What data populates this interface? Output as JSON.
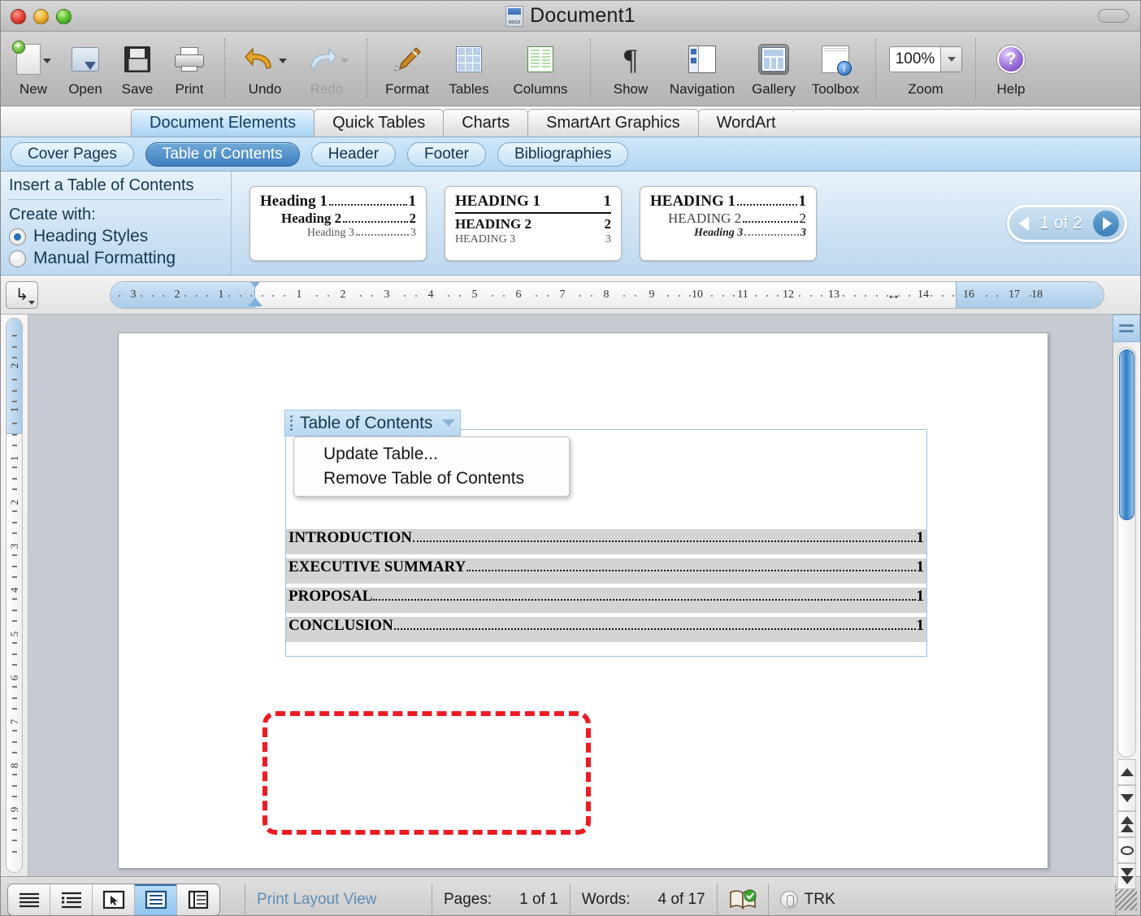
{
  "window": {
    "title": "Document1",
    "doc_icon": "docx-file-icon",
    "traffic_lights": [
      "close",
      "minimize",
      "zoom"
    ]
  },
  "toolbar": {
    "items": [
      {
        "label": "New",
        "icon": "new-document-icon",
        "has_menu": true,
        "disabled": false
      },
      {
        "label": "Open",
        "icon": "open-folder-icon",
        "has_menu": false,
        "disabled": false
      },
      {
        "label": "Save",
        "icon": "floppy-disk-icon",
        "has_menu": false,
        "disabled": false
      },
      {
        "label": "Print",
        "icon": "printer-icon",
        "has_menu": false,
        "disabled": false
      },
      {
        "label": "Undo",
        "icon": "undo-arrow-icon",
        "has_menu": true,
        "disabled": false
      },
      {
        "label": "Redo",
        "icon": "redo-arrow-icon",
        "has_menu": true,
        "disabled": true
      },
      {
        "label": "Format",
        "icon": "paintbrush-icon",
        "has_menu": false,
        "disabled": false
      },
      {
        "label": "Tables",
        "icon": "table-grid-icon",
        "has_menu": false,
        "disabled": false
      },
      {
        "label": "Columns",
        "icon": "columns-icon",
        "has_menu": false,
        "disabled": false
      },
      {
        "label": "Show",
        "icon": "pilcrow-icon",
        "has_menu": false,
        "disabled": false
      },
      {
        "label": "Navigation",
        "icon": "navigation-pane-icon",
        "has_menu": false,
        "disabled": false
      },
      {
        "label": "Gallery",
        "icon": "gallery-icon",
        "has_menu": false,
        "disabled": false
      },
      {
        "label": "Toolbox",
        "icon": "toolbox-info-icon",
        "has_menu": false,
        "disabled": false
      },
      {
        "label": "Zoom",
        "icon": "zoom-combo-icon",
        "has_menu": true,
        "disabled": false
      },
      {
        "label": "Help",
        "icon": "help-question-icon",
        "has_menu": false,
        "disabled": false
      }
    ],
    "zoom_value": "100%"
  },
  "ribbon": {
    "tabs": [
      {
        "label": "Document Elements",
        "active": true
      },
      {
        "label": "Quick Tables",
        "active": false
      },
      {
        "label": "Charts",
        "active": false
      },
      {
        "label": "SmartArt Graphics",
        "active": false
      },
      {
        "label": "WordArt",
        "active": false
      }
    ],
    "subtabs": [
      {
        "label": "Cover Pages",
        "active": false
      },
      {
        "label": "Table of Contents",
        "active": true
      },
      {
        "label": "Header",
        "active": false
      },
      {
        "label": "Footer",
        "active": false
      },
      {
        "label": "Bibliographies",
        "active": false
      }
    ]
  },
  "gallery": {
    "insert_title": "Insert a Table of Contents",
    "create_with_label": "Create with:",
    "options": [
      {
        "label": "Heading Styles",
        "selected": true
      },
      {
        "label": "Manual Formatting",
        "selected": false
      }
    ],
    "thumbnails": [
      {
        "name": "toc-style-1",
        "rows": [
          {
            "text": "Heading 1",
            "page": "1"
          },
          {
            "text": "Heading 2",
            "page": "2"
          },
          {
            "text": "Heading 3",
            "page": "3"
          }
        ]
      },
      {
        "name": "toc-style-2",
        "rows": [
          {
            "text": "HEADING 1",
            "page": "1"
          },
          {
            "text": "HEADING 2",
            "page": "2"
          },
          {
            "text": "HEADING 3",
            "page": "3"
          }
        ]
      },
      {
        "name": "toc-style-3",
        "rows": [
          {
            "text": "HEADING 1",
            "page": "1"
          },
          {
            "text": "HEADING 2",
            "page": "2"
          },
          {
            "text": "Heading 3",
            "page": "3"
          }
        ]
      }
    ],
    "pager": {
      "text": "1 of 2",
      "prev_icon": "chevron-left-icon",
      "next_icon": "chevron-right-icon"
    }
  },
  "ruler": {
    "tab_selector_icon": "tab-stop-icon",
    "horizontal_ticks": [
      "3",
      "2",
      "1",
      "1",
      "2",
      "3",
      "4",
      "5",
      "6",
      "7",
      "8",
      "9",
      "10",
      "11",
      "12",
      "13",
      "14",
      "16",
      "17",
      "18"
    ],
    "vertical_ticks": [
      "2",
      "1",
      "1",
      "2",
      "3",
      "4",
      "5",
      "6",
      "7",
      "8",
      "9"
    ]
  },
  "document": {
    "toc_field": {
      "header_label": "Table of Contents",
      "grip_icon": "drag-grip-icon",
      "caret_icon": "chevron-down-icon",
      "menu_items": [
        "Update Table...",
        "Remove Table of Contents"
      ]
    },
    "toc_entries": [
      {
        "text": "INTRODUCTION",
        "page": "1"
      },
      {
        "text": "EXECUTIVE SUMMARY",
        "page": "1"
      },
      {
        "text": "PROPOSAL",
        "page": "1"
      },
      {
        "text": "CONCLUSION",
        "page": "1"
      }
    ],
    "highlight_color": "#ec1c24"
  },
  "statusbar": {
    "view_buttons": [
      {
        "name": "draft-view",
        "active": false
      },
      {
        "name": "outline-view",
        "active": false
      },
      {
        "name": "publishing-view",
        "active": false
      },
      {
        "name": "print-layout-view",
        "active": true
      },
      {
        "name": "notebook-view",
        "active": false
      }
    ],
    "view_name": "Print Layout View",
    "pages_label": "Pages:",
    "pages_value": "1 of 1",
    "words_label": "Words:",
    "words_value": "4 of 17",
    "spellcheck_icon": "spellcheck-book-icon",
    "track_changes_label": "TRK"
  }
}
